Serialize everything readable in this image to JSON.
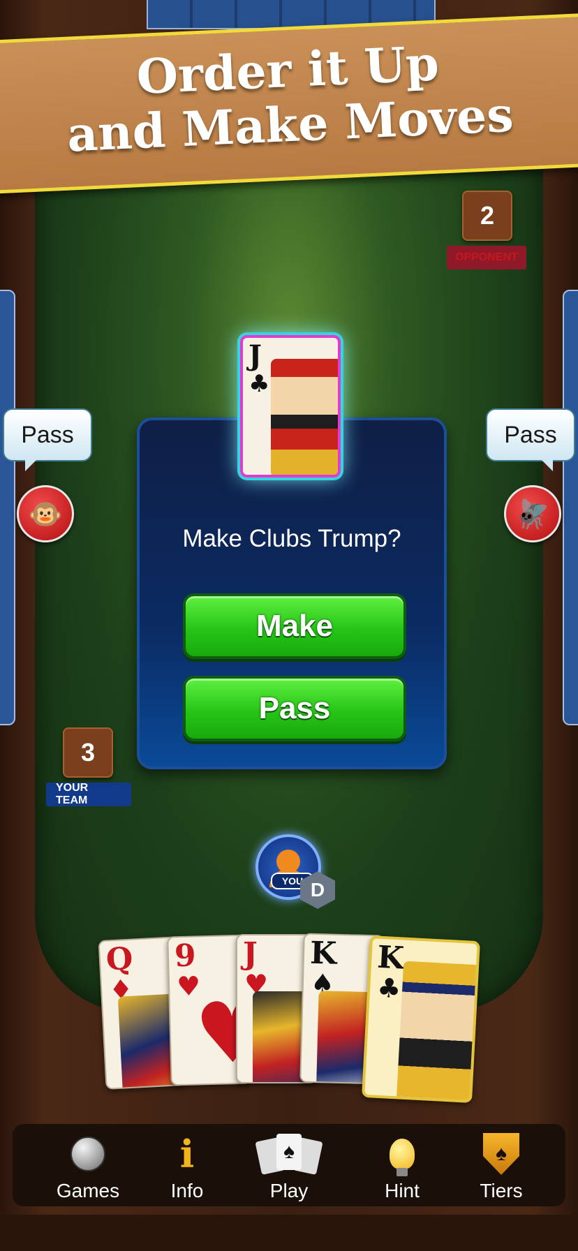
{
  "banner": {
    "line1": "Order it Up",
    "line2": "and Make Moves"
  },
  "scores": {
    "opponent": {
      "value": "2",
      "label": "OPPONENT"
    },
    "your_team": {
      "value": "3",
      "label": "YOUR TEAM"
    }
  },
  "players": {
    "left": {
      "bubble": "Pass",
      "avatar_icon": "monkey-icon"
    },
    "right": {
      "bubble": "Pass",
      "avatar_icon": "fly-icon"
    }
  },
  "trump_card": {
    "rank": "J",
    "suit": "♣"
  },
  "dialog": {
    "question": "Make Clubs Trump?",
    "make_label": "Make",
    "pass_label": "Pass"
  },
  "dealer": {
    "you_label": "YOU",
    "chip": "D"
  },
  "hand": [
    {
      "rank": "Q",
      "suit": "♦"
    },
    {
      "rank": "9",
      "suit": "♥"
    },
    {
      "rank": "J",
      "suit": "♥"
    },
    {
      "rank": "K",
      "suit": "♠"
    },
    {
      "rank": "K",
      "suit": "♣"
    }
  ],
  "nav": {
    "games": "Games",
    "info": "Info",
    "play": "Play",
    "hint": "Hint",
    "tiers": "Tiers"
  },
  "colors": {
    "felt": "#1d3f1a",
    "dialog": "#0b2b63",
    "button_green": "#26c517",
    "banner": "#b77a42"
  }
}
